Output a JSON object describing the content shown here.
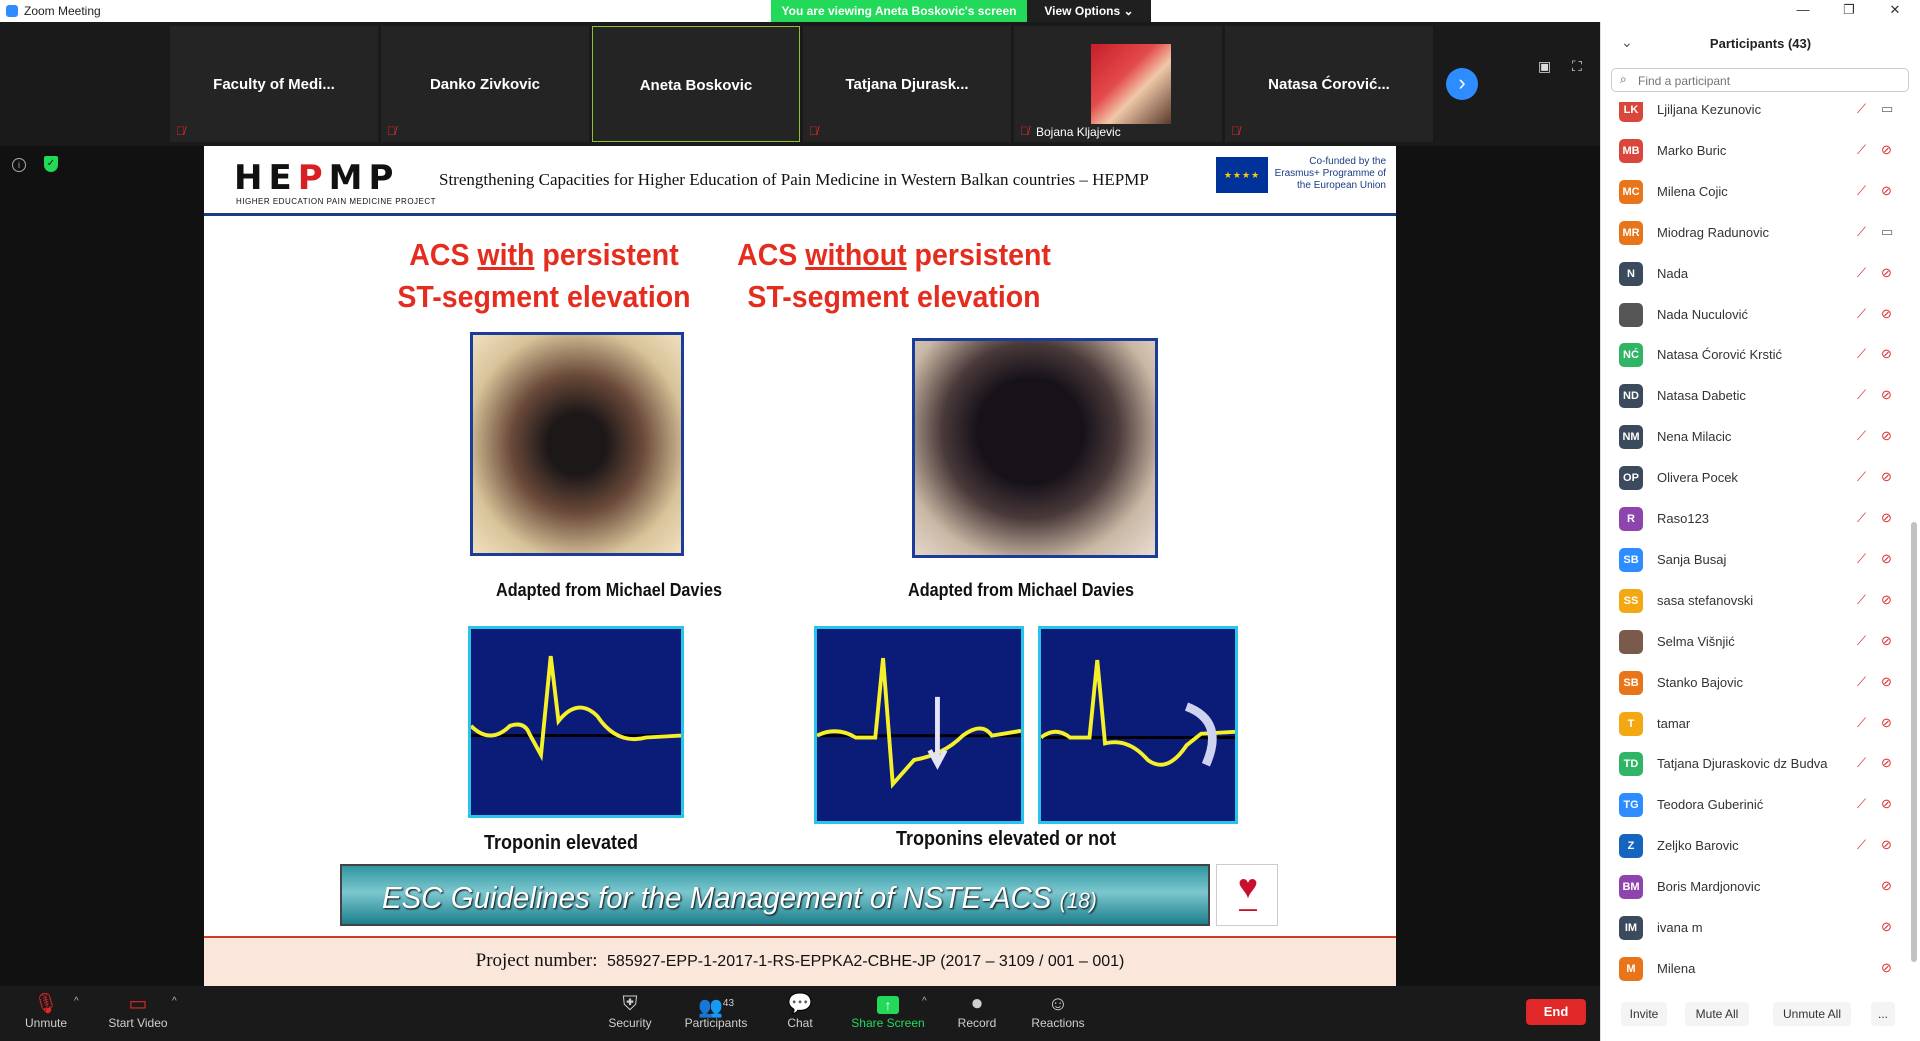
{
  "window": {
    "title": "Zoom Meeting",
    "viewing_banner": "You are viewing Aneta Boskovic's screen",
    "view_options": "View Options"
  },
  "gallery": [
    {
      "name": "Faculty  of  Medi...",
      "muted": true
    },
    {
      "name": "Danko Zivkovic",
      "muted": true
    },
    {
      "name": "Aneta Boskovic",
      "muted": false,
      "active": true
    },
    {
      "name": "Tatjana  Djurask...",
      "muted": true
    },
    {
      "name": "Bojana Kljajevic",
      "muted": true,
      "photo": true
    },
    {
      "name": "Natasa  Ćorović...",
      "muted": true
    }
  ],
  "slide": {
    "logo": "HEPMP",
    "logo_sub": "HIGHER EDUCATION PAIN MEDICINE PROJECT",
    "header_title": "Strengthening Capacities for Higher Education of Pain Medicine in Western Balkan countries – HEPMP",
    "eu_text": "Co-funded by the Erasmus+ Programme of the European Union",
    "left_heading_pre": "ACS ",
    "left_heading_u": "with",
    "left_heading_post": " persistent",
    "left_heading_line2": "ST-segment elevation",
    "right_heading_pre": "ACS ",
    "right_heading_u": "without",
    "right_heading_post": " persistent",
    "right_heading_line2": "ST-segment elevation",
    "caption_left": "Adapted from Michael Davies",
    "caption_right": "Adapted from Michael Davies",
    "trop_left": "Troponin elevated",
    "trop_right": "Troponins elevated or not",
    "banner_main": "ESC Guidelines for the Management of NSTE-ACS ",
    "banner_small": "(18)",
    "footer_label": "Project number:",
    "footer_number": "585927-EPP-1-2017-1-RS-EPPKA2-CBHE-JP (2017 – 3109 / 001 – 001)"
  },
  "toolbar": {
    "unmute": "Unmute",
    "start_video": "Start Video",
    "security": "Security",
    "participants": "Participants",
    "participants_count": "43",
    "chat": "Chat",
    "share_screen": "Share Screen",
    "record": "Record",
    "reactions": "Reactions",
    "end": "End"
  },
  "panel": {
    "title": "Participants (43)",
    "search_placeholder": "Find a participant",
    "invite": "Invite",
    "mute_all": "Mute All",
    "unmute_all": "Unmute All",
    "more": "..."
  },
  "participants": [
    {
      "initials": "LK",
      "name": "Ljiljana Kezunovic",
      "color": "#d9463b",
      "mic": true,
      "cam_on": true
    },
    {
      "initials": "MB",
      "name": "Marko Buric",
      "color": "#d9463b",
      "mic": true,
      "cam_on": false
    },
    {
      "initials": "MC",
      "name": "Milena Cojic",
      "color": "#e8751a",
      "mic": true,
      "cam_on": false
    },
    {
      "initials": "MR",
      "name": "Miodrag Radunovic",
      "color": "#e8751a",
      "mic": true,
      "cam_on": true
    },
    {
      "initials": "N",
      "name": "Nada",
      "color": "#3b4a5c",
      "mic": true,
      "cam_on": false
    },
    {
      "initials": "",
      "name": "Nada Nuculović",
      "color": "#555555",
      "mic": true,
      "cam_on": false,
      "photo": true
    },
    {
      "initials": "NĆ",
      "name": "Natasa Ćorović Krstić",
      "color": "#2fb565",
      "mic": true,
      "cam_on": false
    },
    {
      "initials": "ND",
      "name": "Natasa Dabetic",
      "color": "#3b4a5c",
      "mic": true,
      "cam_on": false
    },
    {
      "initials": "NM",
      "name": "Nena Milacic",
      "color": "#3b4a5c",
      "mic": true,
      "cam_on": false
    },
    {
      "initials": "OP",
      "name": "Olivera Pocek",
      "color": "#3b4a5c",
      "mic": true,
      "cam_on": false
    },
    {
      "initials": "R",
      "name": "Raso123",
      "color": "#8e44ad",
      "mic": true,
      "cam_on": false
    },
    {
      "initials": "SB",
      "name": "Sanja Busaj",
      "color": "#2d8cff",
      "mic": true,
      "cam_on": false
    },
    {
      "initials": "SS",
      "name": "sasa stefanovski",
      "color": "#f3a712",
      "mic": true,
      "cam_on": false
    },
    {
      "initials": "",
      "name": "Selma Višnjić",
      "color": "#7a5a4a",
      "mic": true,
      "cam_on": false,
      "photo": true
    },
    {
      "initials": "SB",
      "name": "Stanko Bajovic",
      "color": "#e8751a",
      "mic": true,
      "cam_on": false
    },
    {
      "initials": "T",
      "name": "tamar",
      "color": "#f3a712",
      "mic": true,
      "cam_on": false
    },
    {
      "initials": "TD",
      "name": "Tatjana Djuraskovic dz Budva",
      "color": "#2fb565",
      "mic": true,
      "cam_on": false
    },
    {
      "initials": "TG",
      "name": "Teodora Guberinić",
      "color": "#2d8cff",
      "mic": true,
      "cam_on": false
    },
    {
      "initials": "Z",
      "name": "Zeljko Barovic",
      "color": "#1565c0",
      "mic": true,
      "cam_on": false
    },
    {
      "initials": "BM",
      "name": "Boris Mardjonovic",
      "color": "#8e44ad",
      "mic": false,
      "cam_on": false
    },
    {
      "initials": "IM",
      "name": "ivana m",
      "color": "#3b4a5c",
      "mic": false,
      "cam_on": false
    },
    {
      "initials": "M",
      "name": "Milena",
      "color": "#e8751a",
      "mic": false,
      "cam_on": false
    }
  ]
}
